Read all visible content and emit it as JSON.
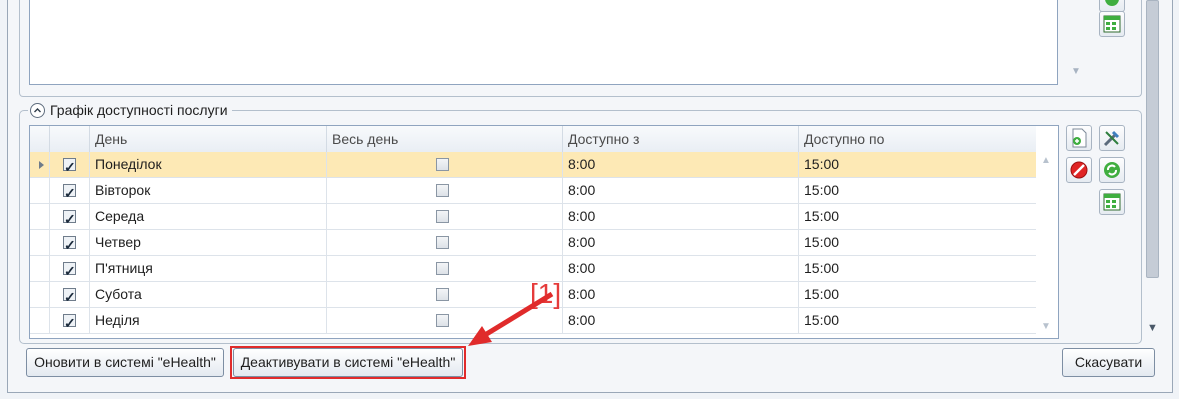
{
  "schedule_group": {
    "title": "Графік доступності послуги"
  },
  "grid": {
    "columns": [
      "День",
      "Весь день",
      "Доступно з",
      "Доступно по"
    ],
    "rows": [
      {
        "enabled": true,
        "day": "Понеділок",
        "all_day": false,
        "from": "8:00",
        "to": "15:00",
        "selected": true
      },
      {
        "enabled": true,
        "day": "Вівторок",
        "all_day": false,
        "from": "8:00",
        "to": "15:00",
        "selected": false
      },
      {
        "enabled": true,
        "day": "Середа",
        "all_day": false,
        "from": "8:00",
        "to": "15:00",
        "selected": false
      },
      {
        "enabled": true,
        "day": "Четвер",
        "all_day": false,
        "from": "8:00",
        "to": "15:00",
        "selected": false
      },
      {
        "enabled": true,
        "day": "П'ятниця",
        "all_day": false,
        "from": "8:00",
        "to": "15:00",
        "selected": false
      },
      {
        "enabled": true,
        "day": "Субота",
        "all_day": false,
        "from": "8:00",
        "to": "15:00",
        "selected": false
      },
      {
        "enabled": true,
        "day": "Неділя",
        "all_day": false,
        "from": "8:00",
        "to": "15:00",
        "selected": false
      }
    ]
  },
  "buttons": {
    "update_ehealth": "Оновити в системі \"eHealth\"",
    "deactivate_ehealth": "Деактивувати в системі \"eHealth\"",
    "cancel": "Скасувати"
  },
  "annotation": {
    "label": "[1]",
    "color": "#e53b3b"
  },
  "icons": {
    "upper_tools": [
      "refresh-green-icon",
      "save-grid-icon"
    ],
    "grid_tools": [
      "add-document-icon",
      "edit-tools-icon",
      "delete-icon",
      "refresh-green-icon",
      "save-grid-icon"
    ]
  }
}
